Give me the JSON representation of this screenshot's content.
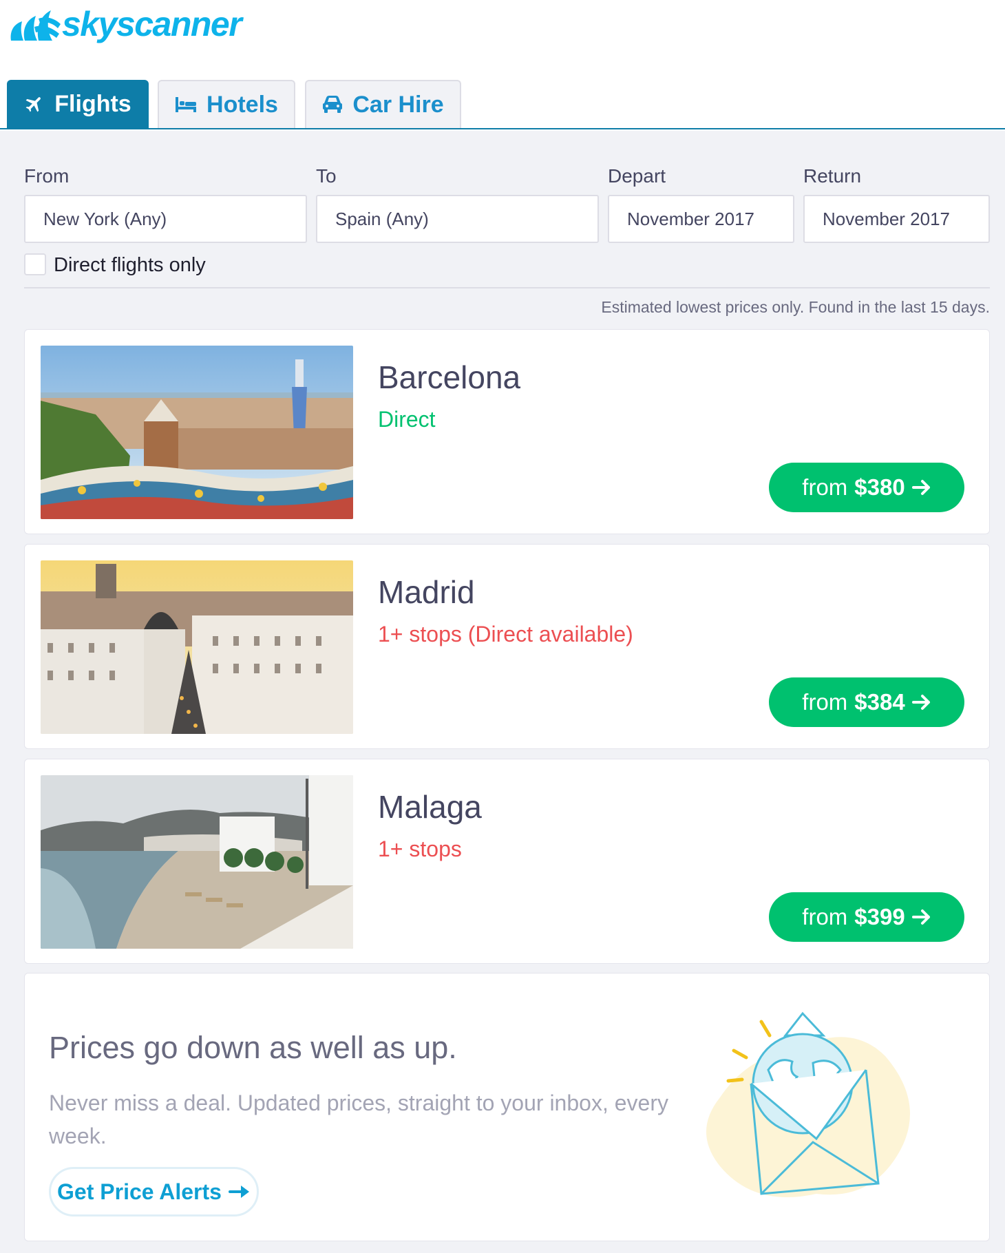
{
  "brand": {
    "name": "skyscanner",
    "color": "#0eb3ea"
  },
  "tabs": [
    {
      "label": "Flights",
      "icon": "plane-icon",
      "active": true
    },
    {
      "label": "Hotels",
      "icon": "bed-icon",
      "active": false
    },
    {
      "label": "Car Hire",
      "icon": "car-icon",
      "active": false
    }
  ],
  "search": {
    "from": {
      "label": "From",
      "value": "New York (Any)"
    },
    "to": {
      "label": "To",
      "value": "Spain (Any)"
    },
    "depart": {
      "label": "Depart",
      "value": "November 2017"
    },
    "return": {
      "label": "Return",
      "value": "November 2017"
    },
    "direct_only": {
      "label": "Direct flights only",
      "checked": false
    }
  },
  "disclaimer": "Estimated lowest prices only. Found in the last 15 days.",
  "results": [
    {
      "city": "Barcelona",
      "stops": "Direct",
      "stops_status": "direct",
      "price_prefix": "from",
      "price": "$380",
      "image": "barcelona-park-guell-photo"
    },
    {
      "city": "Madrid",
      "stops": "1+ stops (Direct available)",
      "stops_status": "indirect",
      "price_prefix": "from",
      "price": "$384",
      "image": "madrid-gran-via-photo"
    },
    {
      "city": "Malaga",
      "stops": "1+ stops",
      "stops_status": "indirect",
      "price_prefix": "from",
      "price": "$399",
      "image": "malaga-beach-photo"
    }
  ],
  "price_alert": {
    "title": "Prices go down as well as up.",
    "body": "Never miss a deal. Updated prices, straight to your inbox, every week.",
    "button": "Get Price Alerts",
    "illustration": "globe-envelope-illustration"
  },
  "colors": {
    "primary": "#0e7da8",
    "green": "#00c16f",
    "red": "#ec4f52",
    "link": "#1b8fcc"
  }
}
